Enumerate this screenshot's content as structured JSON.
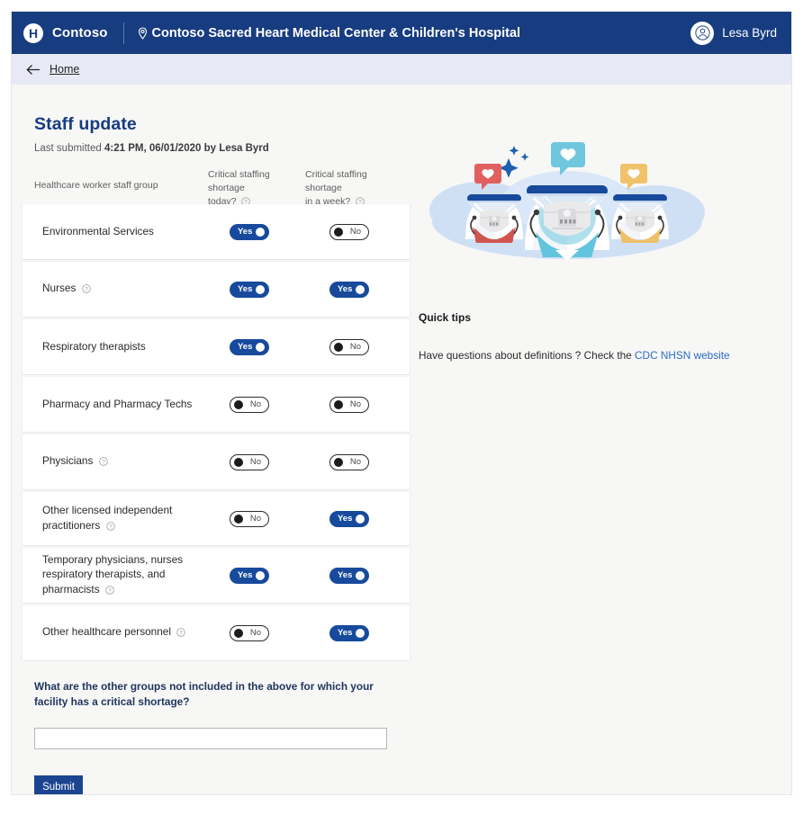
{
  "header": {
    "logo_icon": "hospital-h-icon",
    "brand": "Contoso",
    "location_icon": "map-pin-icon",
    "facility": "Contoso Sacred Heart Medical Center & Children's Hospital",
    "avatar_icon": "person-avatar-icon",
    "user_name": "Lesa Byrd",
    "bar_color": "#173c80"
  },
  "nav": {
    "back_icon": "arrow-left-icon",
    "home_label": "Home",
    "bar_color": "#e7eaf6"
  },
  "page": {
    "title": "Staff update",
    "submitted_prefix": "Last submitted ",
    "submitted_value": "4:21 PM, 06/01/2020 by Lesa Byrd"
  },
  "table": {
    "columns": {
      "group": "Healthcare worker staff group",
      "today_line1": "Critical staffing shortage",
      "today_line2": "today?",
      "week_line1": "Critical staffing shortage",
      "week_line2": "in a week?",
      "help_icon": "help-circle-icon"
    },
    "toggle_labels": {
      "yes": "Yes",
      "no": "No"
    },
    "rows": [
      {
        "label": "Environmental Services",
        "help": false,
        "today": "Yes",
        "week": "No",
        "lines": 1
      },
      {
        "label": "Nurses",
        "help": true,
        "today": "Yes",
        "week": "Yes",
        "lines": 1
      },
      {
        "label": "Respiratory therapists",
        "help": false,
        "today": "Yes",
        "week": "No",
        "lines": 1
      },
      {
        "label": "Pharmacy and Pharmacy Techs",
        "help": false,
        "today": "No",
        "week": "No",
        "lines": 1
      },
      {
        "label": "Physicians",
        "help": true,
        "today": "No",
        "week": "No",
        "lines": 1
      },
      {
        "label": "Other licensed independent practitioners",
        "help": true,
        "today": "No",
        "week": "Yes",
        "lines": 2
      },
      {
        "label": "Temporary physicians, nurses respiratory therapists, and pharmacists",
        "help": true,
        "today": "Yes",
        "week": "Yes",
        "lines": 3
      },
      {
        "label": "Other healthcare personnel",
        "help": true,
        "today": "No",
        "week": "Yes",
        "lines": 1
      }
    ]
  },
  "other_groups": {
    "question": "What are the other groups not included in the above for which your facility has a critical shortage?",
    "value": "",
    "placeholder": ""
  },
  "submit": {
    "label": "Submit",
    "color": "#1b4591"
  },
  "quick_tips": {
    "title": "Quick tips",
    "text_before": "Have questions about definitions ? Check the ",
    "link_text": "CDC NHSN website",
    "link_color": "#2b6cc4"
  },
  "illustration": {
    "name": "healthcare-workers-masks-illustration",
    "description": "Three healthcare workers wearing N95 respirators and face shields with heart speech bubbles"
  }
}
